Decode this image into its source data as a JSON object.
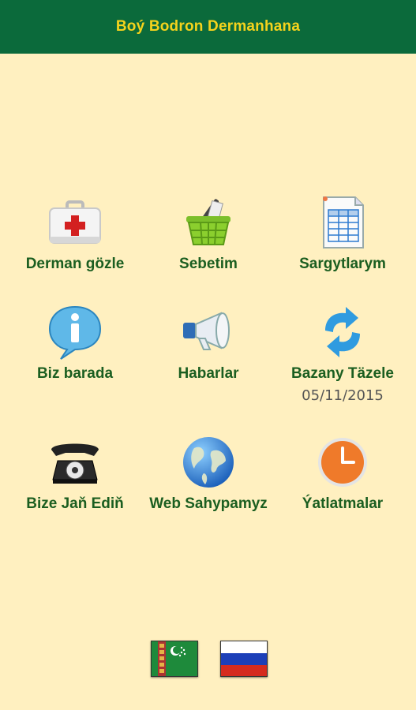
{
  "app": {
    "title": "Boý Bodron Dermanhana",
    "colors": {
      "appbar": "#0b6a3b",
      "title": "#f5d31c",
      "label": "#1b5e20",
      "background": "#fff0c0"
    }
  },
  "menu": {
    "derman_gozle": {
      "label": "Derman gözle",
      "icon": "first-aid-kit-icon"
    },
    "sebetim": {
      "label": "Sebetim",
      "icon": "shopping-basket-icon"
    },
    "sargytlarym": {
      "label": "Sargytlarym",
      "icon": "spreadsheet-icon"
    },
    "biz_barada": {
      "label": "Biz barada",
      "icon": "info-bubble-icon"
    },
    "habarlar": {
      "label": "Habarlar",
      "icon": "megaphone-icon"
    },
    "bazany_tazele": {
      "label": "Bazany Täzele",
      "sub": "05/11/2015",
      "icon": "refresh-icon"
    },
    "bize_jan_edin": {
      "label": "Bize Jaň Ediň",
      "icon": "telephone-icon"
    },
    "web_sahypamyz": {
      "label": "Web Sahypamyz",
      "icon": "globe-icon"
    },
    "yatlatmalar": {
      "label": "Ýatlatmalar",
      "icon": "clock-icon"
    }
  },
  "languages": [
    {
      "name": "turkmen-flag-icon"
    },
    {
      "name": "russian-flag-icon"
    }
  ]
}
